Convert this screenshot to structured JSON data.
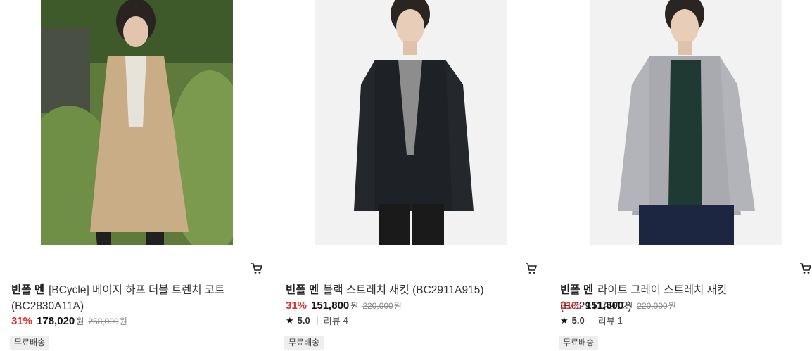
{
  "products": [
    {
      "brand": "빈폴 멘",
      "name": "[BCycle] 베이지 하프 더블 트렌치 코트 (BC2830A11A)",
      "discount": "31%",
      "price": "178,020",
      "currency": "원",
      "original_price": "258,000",
      "shipping": "무료배송"
    },
    {
      "brand": "빈폴 멘",
      "name": "블랙 스트레치 재킷 (BC2911A915)",
      "discount": "31%",
      "price": "151,800",
      "currency": "원",
      "original_price": "220,000",
      "rating": "5.0",
      "review_label": "리뷰",
      "review_count": "4",
      "shipping": "무료배송"
    },
    {
      "brand": "빈폴 멘",
      "name": "라이트 그레이 스트레치 재킷 (BC2911A912)",
      "discount": "31%",
      "price": "151,800",
      "currency": "원",
      "original_price": "220,000",
      "rating": "5.0",
      "review_label": "리뷰",
      "review_count": "1",
      "shipping": "무료배송"
    }
  ],
  "icons": {
    "cart": "cart-icon",
    "star": "star-icon"
  },
  "colors": {
    "discount": "#e02f2f",
    "badge_bg": "#eeeeee"
  }
}
